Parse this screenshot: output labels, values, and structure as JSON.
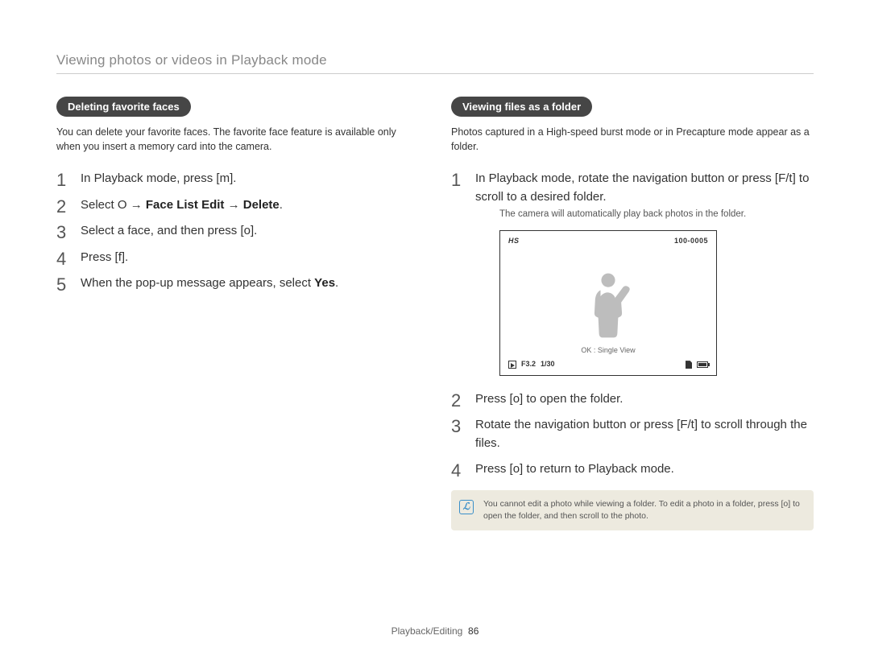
{
  "page_title": "Viewing photos or videos in Playback mode",
  "left": {
    "heading": "Deleting favorite faces",
    "intro": "You can delete your favorite faces. The favorite face feature is available only when you insert a memory card into the camera.",
    "steps": {
      "s1_a": "In Playback mode, press [",
      "s1_key": "m",
      "s1_b": "].",
      "s2_a": "Select ",
      "s2_icon": "O",
      "s2_arrow1": " → ",
      "s2_b1": "Face List Edit",
      "s2_arrow2": " → ",
      "s2_b2": "Delete",
      "s2_c": ".",
      "s3_a": "Select a face, and then press [",
      "s3_key": "o",
      "s3_b": "].",
      "s4_a": "Press [",
      "s4_key": "f",
      "s4_b": "].",
      "s5_a": "When the pop-up message appears, select ",
      "s5_b": "Yes",
      "s5_c": "."
    }
  },
  "right": {
    "heading": "Viewing files as a folder",
    "intro": "Photos captured in a High-speed burst mode or in Precapture mode appear as a folder.",
    "steps": {
      "s1_a": "In Playback mode, rotate the navigation button or press [",
      "s1_key": "F",
      "s1_mid": "/",
      "s1_key2": "t",
      "s1_b": "] to scroll to a desired folder.",
      "s1_note": "The camera will automatically play back photos in the folder.",
      "s2_a": "Press [",
      "s2_key": "o",
      "s2_b": "] to open the folder.",
      "s3_a": "Rotate the navigation button or press [",
      "s3_key": "F",
      "s3_mid": "/",
      "s3_key2": "t",
      "s3_b": "] to scroll through the files.",
      "s4_a": "Press [",
      "s4_key": "o",
      "s4_b": "] to return to Playback mode."
    },
    "screen": {
      "mode_label": "HS",
      "file_no": "100-0005",
      "ok_text": "OK : Single View",
      "fstop": "F3.2",
      "shutter": "1/30"
    },
    "note_a": "You cannot edit a photo while viewing a folder. To edit a photo in a folder, press [",
    "note_key": "o",
    "note_b": "] to open the folder, and then scroll to the photo."
  },
  "footer": {
    "section": "Playback/Editing",
    "page": "86"
  }
}
